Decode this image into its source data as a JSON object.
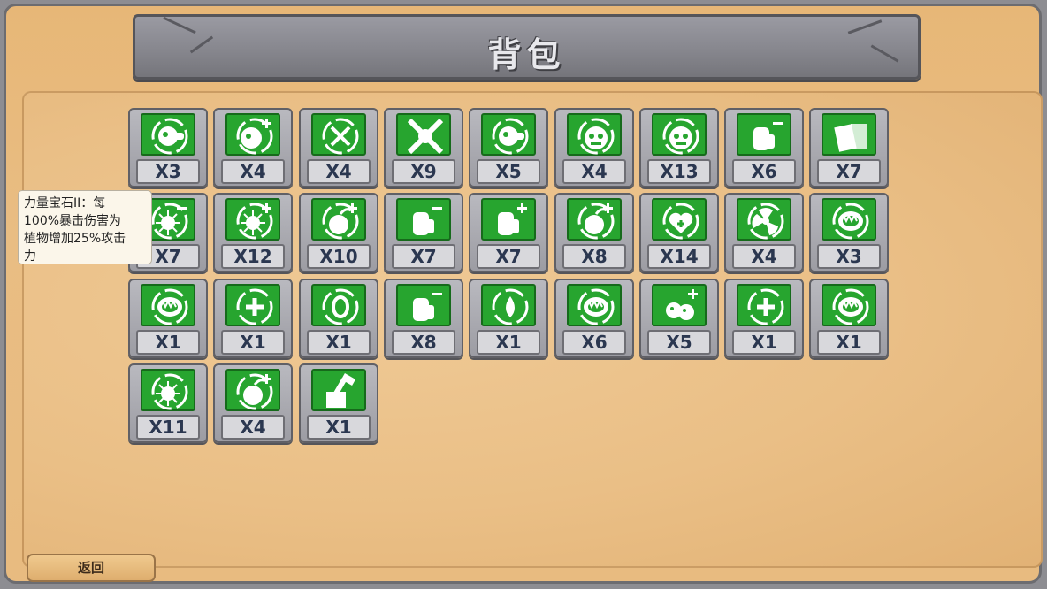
{
  "title": "背包",
  "tooltip": {
    "lines": [
      "力量宝石II：每",
      "100%暴击伤害为",
      "植物增加25%攻击",
      "力"
    ]
  },
  "back_label": "返回",
  "items": [
    {
      "icon": "peashooter-icon",
      "count": "X3"
    },
    {
      "icon": "seed-plus-icon",
      "count": "X4"
    },
    {
      "icon": "target-cross-icon",
      "count": "X4"
    },
    {
      "icon": "crosshair-x-icon",
      "count": "X9"
    },
    {
      "icon": "repeater-icon",
      "count": "X5"
    },
    {
      "icon": "zombie-face-icon",
      "count": "X4"
    },
    {
      "icon": "crowned-zombie-icon",
      "count": "X13"
    },
    {
      "icon": "hand-minus-icon",
      "count": "X6"
    },
    {
      "icon": "card-icon",
      "count": "X7"
    },
    {
      "icon": "sun-minus-icon",
      "count": "X7"
    },
    {
      "icon": "sun-plus-icon",
      "count": "X12"
    },
    {
      "icon": "cherry-bomb-icon",
      "count": "X10"
    },
    {
      "icon": "fist-minus-icon",
      "count": "X7"
    },
    {
      "icon": "fist-plus-icon",
      "count": "X7"
    },
    {
      "icon": "bomb-plus-icon",
      "count": "X8"
    },
    {
      "icon": "heart-plus-icon",
      "count": "X14"
    },
    {
      "icon": "fan-icon",
      "count": "X4"
    },
    {
      "icon": "chomper-icon",
      "count": "X3"
    },
    {
      "icon": "chomper-icon",
      "count": "X1"
    },
    {
      "icon": "circle-plus-icon",
      "count": "X1"
    },
    {
      "icon": "zero-icon",
      "count": "X1"
    },
    {
      "icon": "hammer-minus-icon",
      "count": "X8"
    },
    {
      "icon": "drop-icon",
      "count": "X1"
    },
    {
      "icon": "flame-mouth-icon",
      "count": "X6"
    },
    {
      "icon": "seeds-plus-icon",
      "count": "X5"
    },
    {
      "icon": "heat-plus-icon",
      "count": "X1"
    },
    {
      "icon": "chomper-icon",
      "count": "X1"
    },
    {
      "icon": "gear-sun-icon",
      "count": "X11"
    },
    {
      "icon": "bomb-plus-icon",
      "count": "X4"
    },
    {
      "icon": "hammer-box-icon",
      "count": "X1"
    }
  ],
  "colors": {
    "icon_bg": "#27a52f",
    "count_text": "#2b3750",
    "panel": "#e9bd83"
  }
}
